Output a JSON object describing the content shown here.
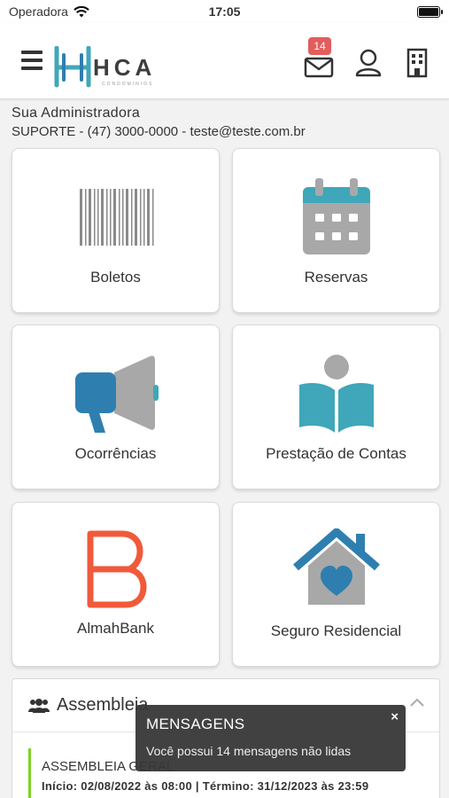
{
  "status_bar": {
    "carrier": "Operadora",
    "time": "17:05"
  },
  "header": {
    "logo_text": "HCA",
    "logo_sub": "CONDOMINIOS",
    "unread_count": "14"
  },
  "admin": {
    "title": "Sua Administradora",
    "contact": "SUPORTE - (47) 3000-0000 - teste@teste.com.br"
  },
  "tiles": [
    {
      "label": "Boletos",
      "icon": "barcode-icon"
    },
    {
      "label": "Reservas",
      "icon": "calendar-icon"
    },
    {
      "label": "Ocorrências",
      "icon": "megaphone-icon"
    },
    {
      "label": "Prestação de Contas",
      "icon": "reading-book-icon"
    },
    {
      "label": "AlmahBank",
      "icon": "almahbank-logo"
    },
    {
      "label": "Seguro Residencial",
      "icon": "house-heart-icon"
    }
  ],
  "assembleia": {
    "title": "Assembleia",
    "item": {
      "name": "ASSEMBLEIA GERAL",
      "dates": "Início: 02/08/2022 às 08:00 | Término: 31/12/2023 às 23:59"
    }
  },
  "toast": {
    "title": "MENSAGENS",
    "message": "Você possui 14 mensagens não lidas",
    "close": "×"
  },
  "colors": {
    "teal": "#3fa7b9",
    "blue": "#2e7fb0",
    "gray": "#a8a8a8",
    "orange": "#f05a3a",
    "green": "#7ed321",
    "badge": "#e35d5d"
  }
}
